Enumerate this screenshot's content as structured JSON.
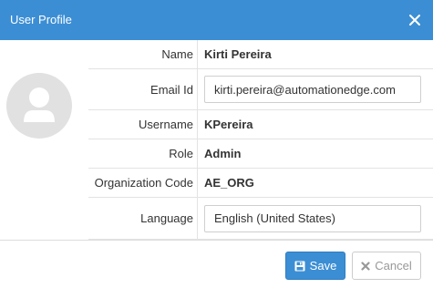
{
  "dialog": {
    "title": "User Profile",
    "close_icon": "close-icon"
  },
  "avatar": {
    "icon": "user-avatar-icon"
  },
  "fields": {
    "name": {
      "label": "Name",
      "value": "Kirti Pereira"
    },
    "email": {
      "label": "Email Id",
      "value": "kirti.pereira@automationedge.com"
    },
    "username": {
      "label": "Username",
      "value": "KPereira"
    },
    "role": {
      "label": "Role",
      "value": "Admin"
    },
    "org_code": {
      "label": "Organization Code",
      "value": "AE_ORG"
    },
    "language": {
      "label": "Language",
      "value": "English (United States)"
    }
  },
  "buttons": {
    "save_label": "Save",
    "save_icon": "floppy-disk-icon",
    "cancel_label": "Cancel",
    "cancel_icon": "x-icon"
  },
  "colors": {
    "header": "#3c8ed4",
    "primary_button": "#3c8ed4",
    "avatar_bg": "#e1e1e1"
  }
}
